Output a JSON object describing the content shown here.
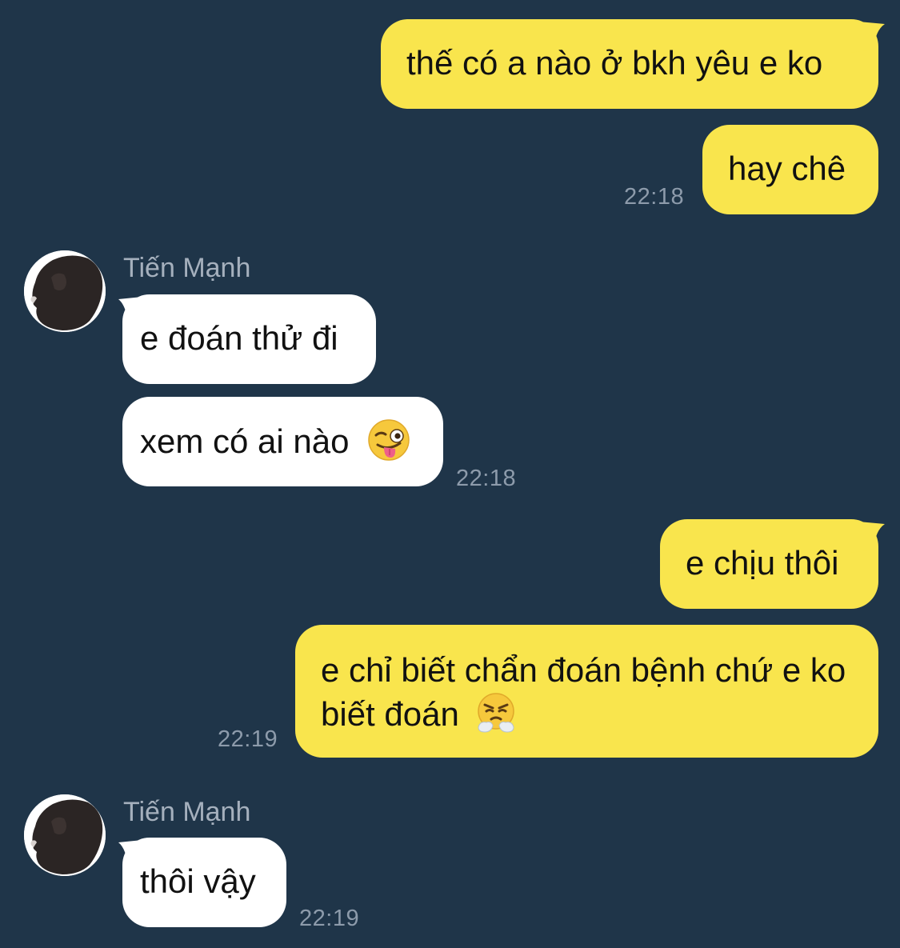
{
  "colors": {
    "background": "#1f3549",
    "outgoing_bubble": "#f9e54d",
    "incoming_bubble": "#ffffff",
    "timestamp": "#8d9bab",
    "sender_name": "#a5b0bd"
  },
  "messages": [
    {
      "direction": "out",
      "text": "thế có a nào ở bkh yêu e ko"
    },
    {
      "direction": "out",
      "text": "hay chê",
      "time": "22:18"
    },
    {
      "direction": "in",
      "sender": "Tiến Mạnh",
      "avatar_icon": "profile-silhouette-avatar",
      "text": "e đoán thử đi"
    },
    {
      "direction": "in",
      "text": "xem có ai nào",
      "emoji": "winking-face-with-tongue-icon",
      "time": "22:18"
    },
    {
      "direction": "out",
      "text": "e chịu thôi"
    },
    {
      "direction": "out",
      "text": "e chỉ biết chẩn đoán bệnh chứ e ko biết đoán",
      "emoji": "face-with-steam-from-nose-icon",
      "time": "22:19"
    },
    {
      "direction": "in",
      "sender": "Tiến Mạnh",
      "avatar_icon": "profile-silhouette-avatar",
      "text": "thôi vậy",
      "time": "22:19"
    }
  ]
}
